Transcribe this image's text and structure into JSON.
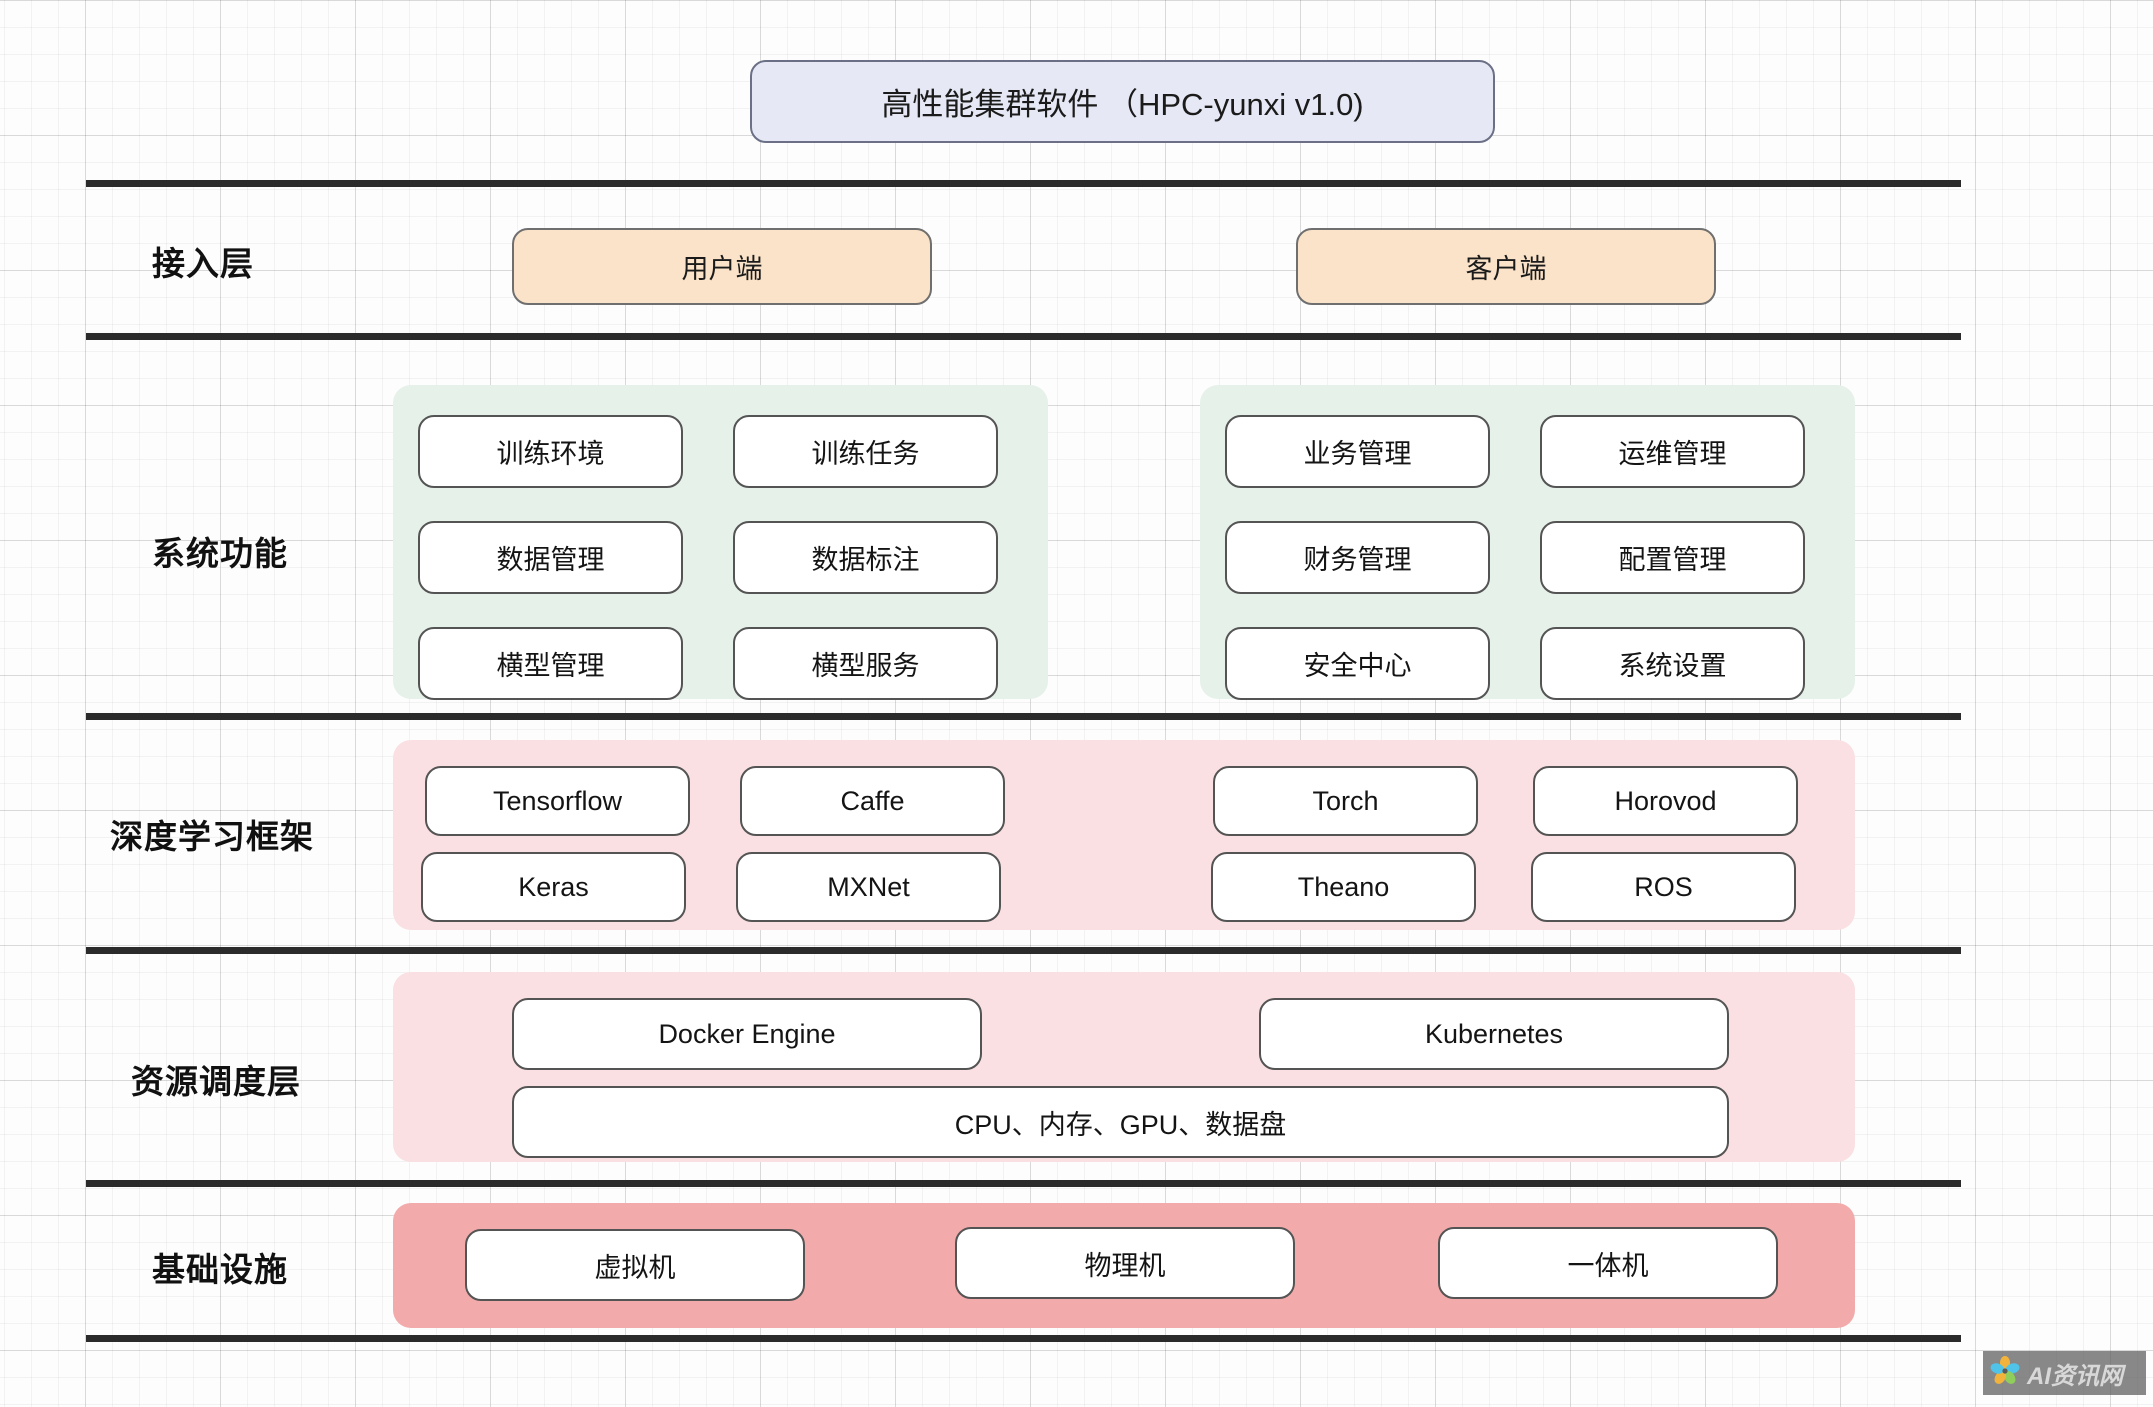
{
  "title": {
    "text": "高性能集群软件 （HPC-yunxi v1.0)"
  },
  "layers": [
    {
      "id": "access",
      "label": "接入层",
      "boxes": [
        "用户端",
        "客户端"
      ]
    },
    {
      "id": "system-functions",
      "label": "系统功能",
      "groups": [
        {
          "id": "left",
          "items": [
            "训练环境",
            "训练任务",
            "数据管理",
            "数据标注",
            "横型管理",
            "横型服务"
          ]
        },
        {
          "id": "right",
          "items": [
            "业务管理",
            "运维管理",
            "财务管理",
            "配置管理",
            "安全中心",
            "系统设置"
          ]
        }
      ]
    },
    {
      "id": "deep-learning-frameworks",
      "label": "深度学习框架",
      "groups": [
        {
          "id": "left",
          "items": [
            "Tensorflow",
            "Caffe",
            "Keras",
            "MXNet"
          ]
        },
        {
          "id": "right",
          "items": [
            "Torch",
            "Horovod",
            "Theano",
            "ROS"
          ]
        }
      ]
    },
    {
      "id": "resource-scheduling",
      "label": "资源调度层",
      "items": [
        "Docker Engine",
        "Kubernetes",
        "CPU、内存、GPU、数据盘"
      ]
    },
    {
      "id": "infrastructure",
      "label": "基础设施",
      "items": [
        "虚拟机",
        "物理机",
        "一体机"
      ]
    }
  ],
  "watermark": {
    "text": "AI资讯网",
    "logo_icon": "flower-logo-icon"
  },
  "colors": {
    "title_fill": "#e6e9f5",
    "access_fill": "#fbe3c9",
    "group_green": "#e6f1ea",
    "group_pink": "#fae0e2",
    "group_rose": "#f2aaaa",
    "cell_fill": "#ffffff",
    "divider": "#2b2b2b"
  }
}
